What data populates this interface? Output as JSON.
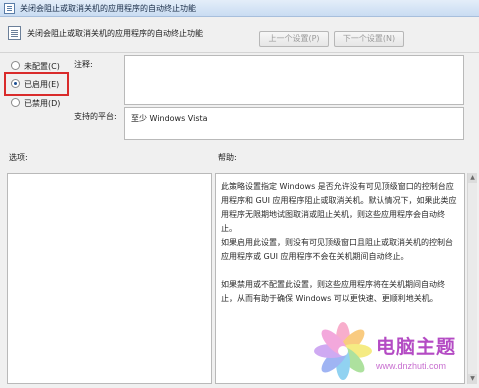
{
  "window": {
    "title": "关闭会阻止或取消关机的应用程序的自动终止功能",
    "icon": "policy-document-icon"
  },
  "header": {
    "policy_name": "关闭会阻止或取消关机的应用程序的自动终止功能",
    "icon": "policy-setting-icon"
  },
  "navigation": {
    "prev_label": "上一个设置(P)",
    "next_label": "下一个设置(N)"
  },
  "state": {
    "options": [
      {
        "label": "未配置(C)",
        "selected": false
      },
      {
        "label": "已启用(E)",
        "selected": true
      },
      {
        "label": "已禁用(D)",
        "selected": false
      }
    ]
  },
  "note": {
    "label": "注释:",
    "value": ""
  },
  "platform": {
    "label": "支持的平台:",
    "value": "至少 Windows Vista"
  },
  "options_section": {
    "label": "选项:"
  },
  "help_section": {
    "label": "帮助:",
    "paragraphs": [
      "此策略设置指定 Windows 是否允许没有可见顶级窗口的控制台应用程序和 GUI 应用程序阻止或取消关机。默认情况下，如果此类应用程序无限期地试图取消或阻止关机，则这些应用程序会自动终止。",
      "如果启用此设置，则没有可见顶级窗口且阻止或取消关机的控制台应用程序或 GUI 应用程序不会在关机期间自动终止。",
      "如果禁用或不配置此设置，则这些应用程序将在关机期间自动终止，从而有助于确保 Windows 可以更快速、更顺利地关机。"
    ]
  },
  "watermark": {
    "name": "电脑主题",
    "url": "www.dnzhuti.com"
  },
  "colors": {
    "highlight": "#d92b2b",
    "watermark_text": "#b44bc4",
    "selected_radio": "#1d4f91"
  }
}
